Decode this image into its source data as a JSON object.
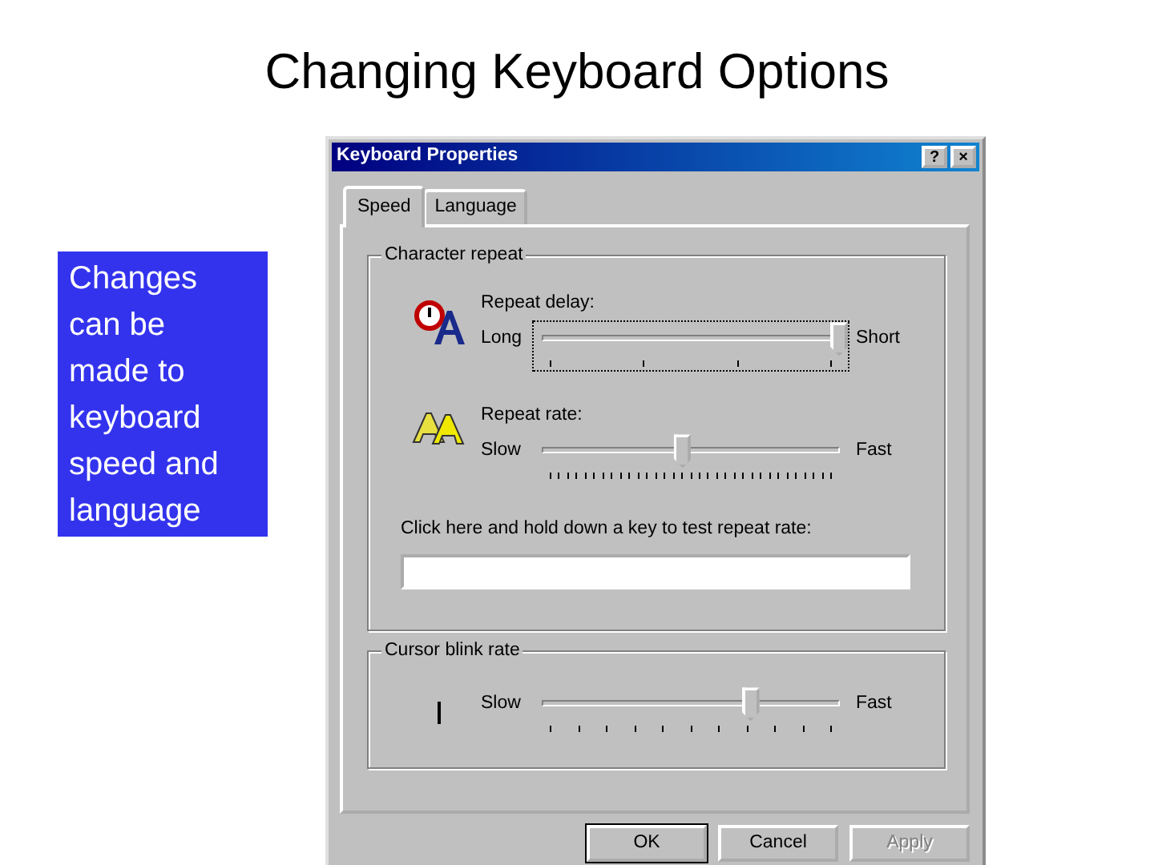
{
  "slide": {
    "title": "Changing Keyboard Options",
    "callout": "Changes can be made to keyboard speed and language"
  },
  "dialog": {
    "title": "Keyboard Properties",
    "title_buttons": [
      "?",
      "×"
    ],
    "tabs": [
      {
        "label": "Speed",
        "selected": true
      },
      {
        "label": "Language",
        "selected": false
      }
    ],
    "groups": [
      {
        "label": "Character repeat",
        "items": [
          {
            "kind": "slider",
            "caption": "Repeat delay:",
            "min_label": "Long",
            "max_label": "Short",
            "level": 1,
            "focused": true
          },
          {
            "kind": "slider",
            "caption": "Repeat rate:",
            "min_label": "Slow",
            "max_label": "Fast",
            "level": 0.47,
            "focused": false
          },
          {
            "kind": "test-field",
            "label": "Click here and hold down a key to test repeat rate:"
          }
        ]
      },
      {
        "label": "Cursor blink rate",
        "items": [
          {
            "kind": "slider",
            "min_label": "Slow",
            "max_label": "Fast",
            "level": 0.7,
            "focused": false
          }
        ]
      }
    ],
    "buttons": [
      {
        "label": "OK",
        "default": true,
        "disabled": false
      },
      {
        "label": "Cancel",
        "default": false,
        "disabled": false
      },
      {
        "label": "Apply",
        "default": false,
        "disabled": true
      }
    ]
  }
}
